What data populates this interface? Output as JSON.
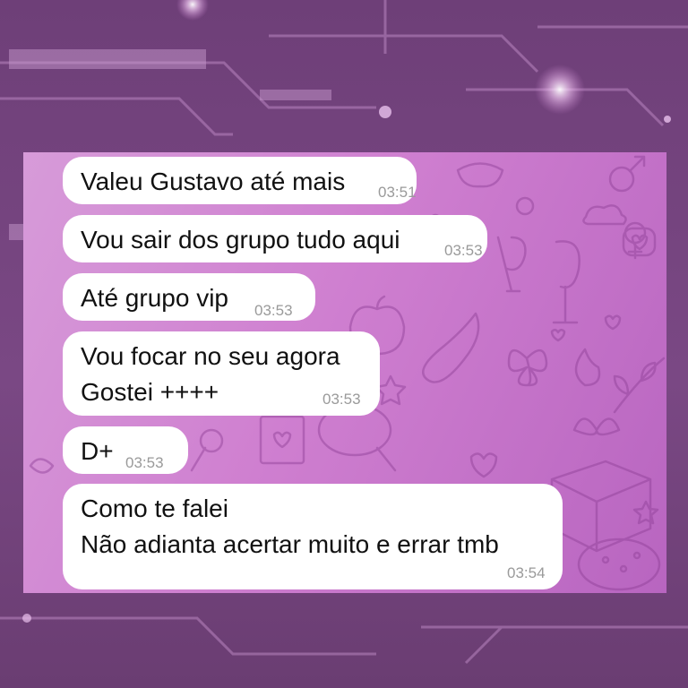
{
  "messages": [
    {
      "text": "Valeu Gustavo até mais",
      "time": "03:51"
    },
    {
      "text": "Vou sair dos grupo tudo aqui",
      "time": "03:53"
    },
    {
      "text": "Até grupo vip",
      "time": "03:53"
    },
    {
      "lines": [
        "Vou focar no seu agora",
        "Gostei ++++"
      ],
      "time": "03:53"
    },
    {
      "text": "D+",
      "time": "03:53"
    },
    {
      "lines": [
        "Como te falei",
        "Não adianta acertar muito e errar tmb"
      ],
      "time": "03:54"
    }
  ],
  "colors": {
    "outer_background": "#74437e",
    "chat_wallpaper_start": "#d79bd9",
    "chat_wallpaper_end": "#b865c0",
    "bubble": "#ffffff",
    "timestamp": "#9a9a9a"
  }
}
